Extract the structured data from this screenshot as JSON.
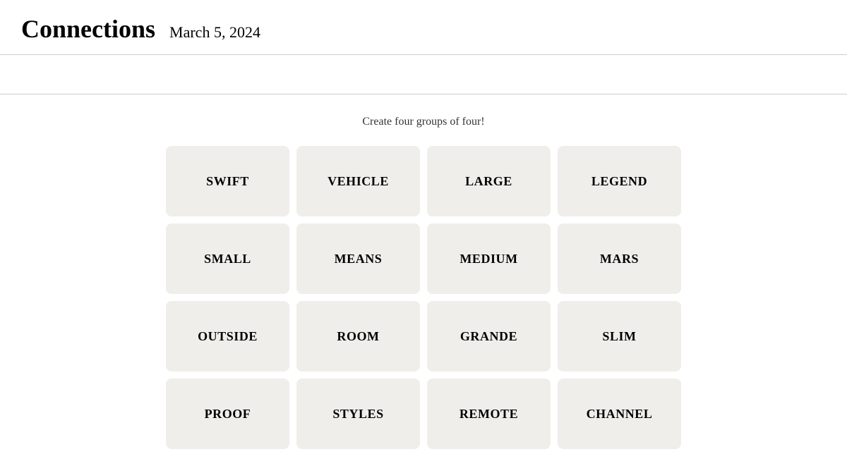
{
  "header": {
    "title": "Connections",
    "date": "March 5, 2024"
  },
  "main": {
    "subtitle": "Create four groups of four!",
    "tiles": [
      {
        "label": "SWIFT"
      },
      {
        "label": "VEHICLE"
      },
      {
        "label": "LARGE"
      },
      {
        "label": "LEGEND"
      },
      {
        "label": "SMALL"
      },
      {
        "label": "MEANS"
      },
      {
        "label": "MEDIUM"
      },
      {
        "label": "MARS"
      },
      {
        "label": "OUTSIDE"
      },
      {
        "label": "ROOM"
      },
      {
        "label": "GRANDE"
      },
      {
        "label": "SLIM"
      },
      {
        "label": "PROOF"
      },
      {
        "label": "STYLES"
      },
      {
        "label": "REMOTE"
      },
      {
        "label": "CHANNEL"
      }
    ]
  }
}
